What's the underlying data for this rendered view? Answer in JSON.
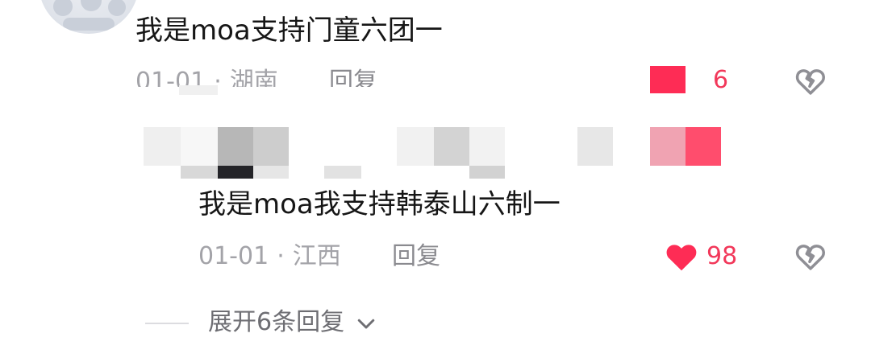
{
  "comment1": {
    "text": "我是moa支持门童六团一",
    "date": "01-01",
    "location": "湖南",
    "reply_label": "回复",
    "like_count": "6"
  },
  "reply1": {
    "text": "我是moa我支持韩泰山六制一",
    "date": "01-01",
    "location": "江西",
    "reply_label": "回复",
    "like_count": "98"
  },
  "expand": {
    "label": "展开6条回复"
  },
  "colors": {
    "like_active": "#fe2c55",
    "meta_text": "#a3a3a8",
    "body_text": "#161616"
  },
  "icons": [
    "heart-icon",
    "broken-heart-icon",
    "chevron-down-icon"
  ]
}
